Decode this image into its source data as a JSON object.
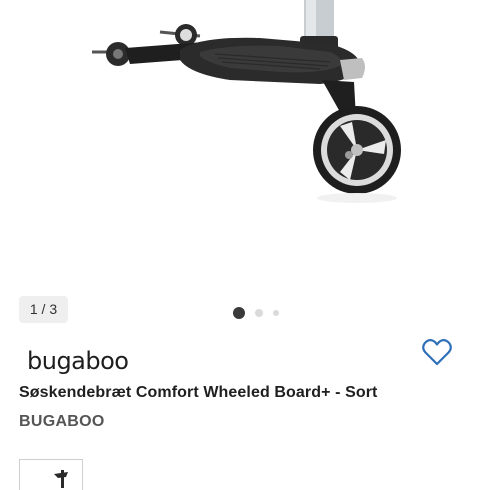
{
  "gallery": {
    "image_alt": "Bugabo Comfort Wheeled Board+ product image",
    "counter": "1 / 3",
    "slides": 3,
    "active_slide": 1
  },
  "product": {
    "brand_logo_text": "bugaboo",
    "title": "Søskendebræt Comfort Wheeled Board+ - Sort",
    "brand": "BUGABOO"
  },
  "icons": {
    "wishlist": "heart-outline-icon"
  },
  "colors": {
    "accent": "#2f6fb7",
    "text": "#1f1f1f",
    "muted": "#555555",
    "badge_bg": "#efefef",
    "dot_active": "#3a3a3a",
    "dot_inactive": "#dadada"
  }
}
